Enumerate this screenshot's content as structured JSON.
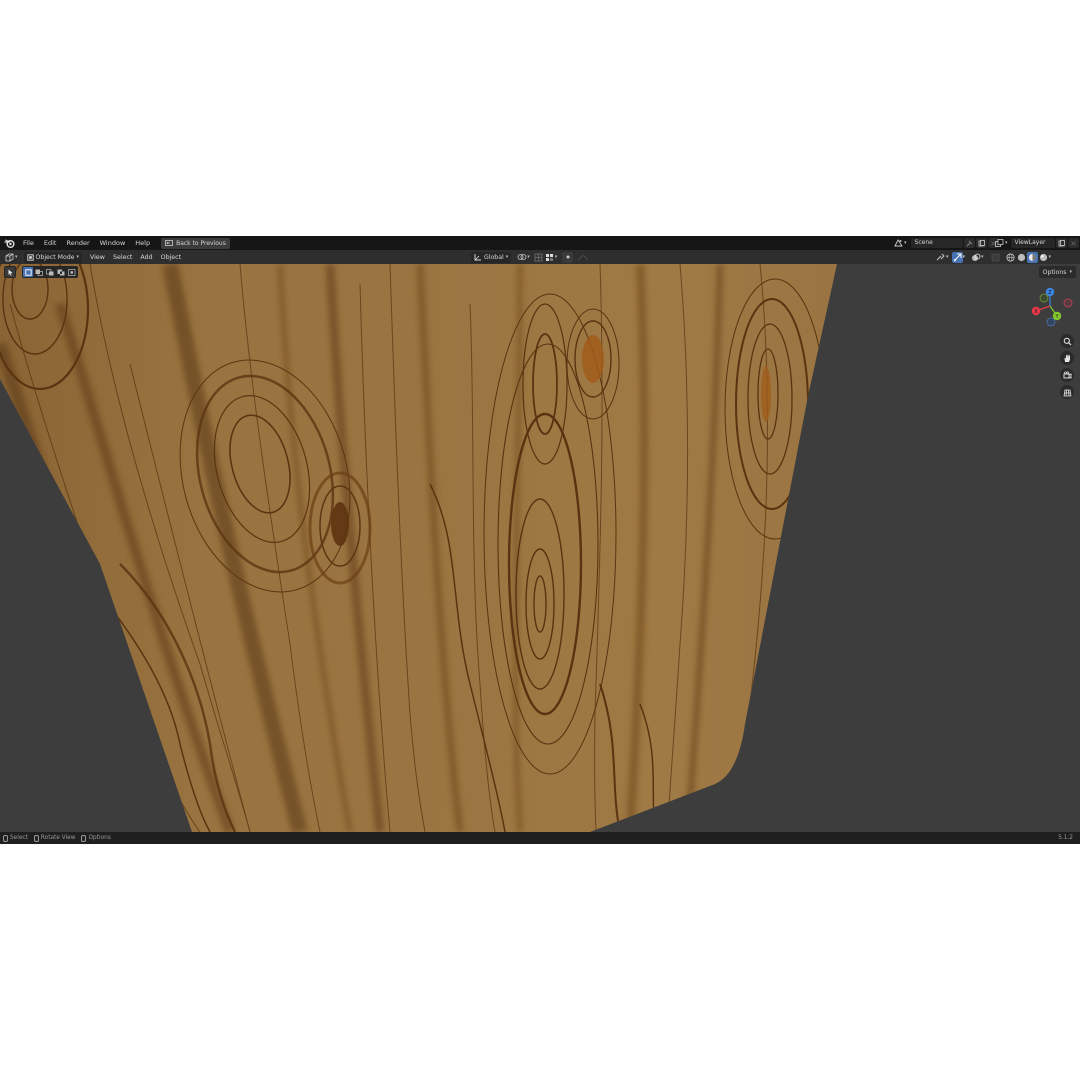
{
  "topbar": {
    "menus": [
      "File",
      "Edit",
      "Render",
      "Window",
      "Help"
    ],
    "back_button": "Back to Previous",
    "scene": "Scene",
    "view_layer": "ViewLayer"
  },
  "viewport_header": {
    "mode": "Object Mode",
    "menus": [
      "View",
      "Select",
      "Add",
      "Object"
    ],
    "transform_orientation": "Global"
  },
  "toolbar": {
    "options_label": "Options"
  },
  "gizmo": {
    "axes": [
      "X",
      "Y",
      "Z"
    ],
    "colors": {
      "x": "#e8394a",
      "y": "#82c82b",
      "z": "#3c86e6"
    }
  },
  "statusbar": {
    "items": [
      "Select",
      "Rotate View",
      "Options"
    ],
    "version": "5.1.2"
  },
  "colors": {
    "viewport_bg": "#3d3d3d",
    "wood_base": "#9a7440",
    "wood_grain": "#5e3a16",
    "accent": "#4772b3"
  }
}
